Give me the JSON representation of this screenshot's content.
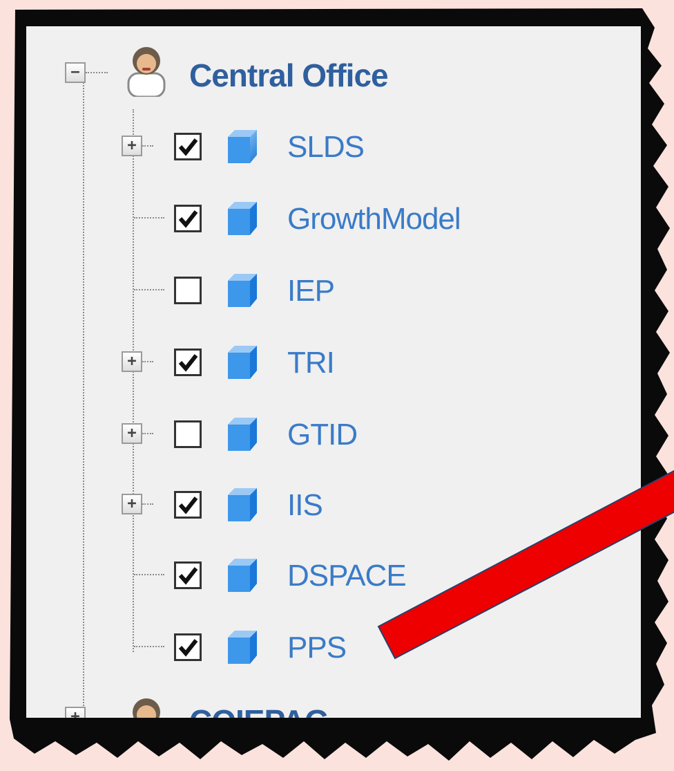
{
  "tree": {
    "root": {
      "label": "Central Office",
      "expander": "−",
      "icon": "person-icon"
    },
    "children": [
      {
        "label": "SLDS",
        "checked": true,
        "expander": "+"
      },
      {
        "label": "GrowthModel",
        "checked": true,
        "expander": null
      },
      {
        "label": "IEP",
        "checked": false,
        "expander": null
      },
      {
        "label": "TRI",
        "checked": true,
        "expander": "+"
      },
      {
        "label": "GTID",
        "checked": false,
        "expander": "+"
      },
      {
        "label": "IIS",
        "checked": true,
        "expander": "+"
      },
      {
        "label": "DSPACE",
        "checked": true,
        "expander": null
      },
      {
        "label": "PPS",
        "checked": true,
        "expander": null
      }
    ],
    "next_root": {
      "label": "COIEPAG",
      "expander": "+"
    }
  },
  "annotation": {
    "arrow_color": "#ee0000",
    "arrow_outline": "#2a3f6a",
    "target": "PPS"
  },
  "colors": {
    "label": "#3a7bc8",
    "root_label": "#2f5f9e",
    "panel": "#f0f0f0",
    "background": "#fbe2dd"
  }
}
